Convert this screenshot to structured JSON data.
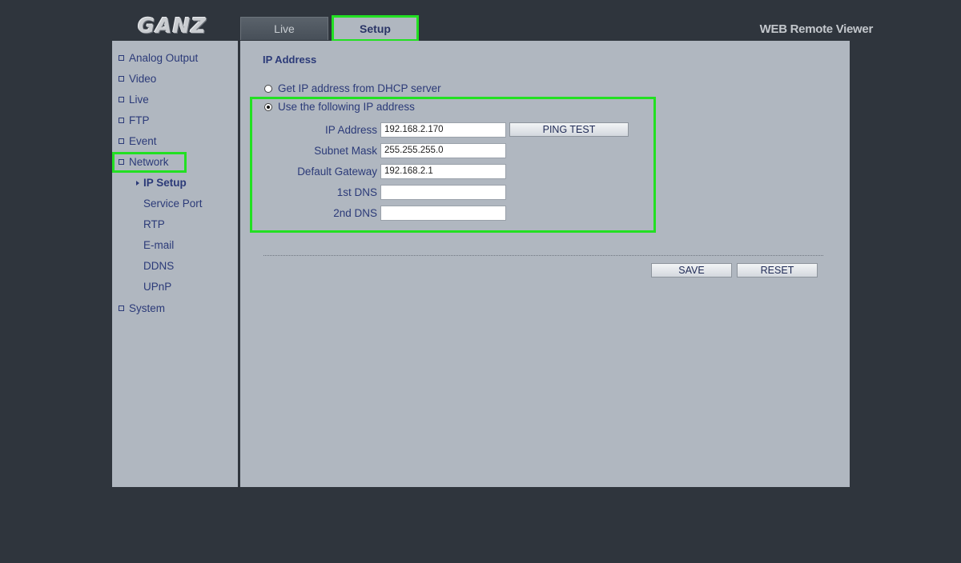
{
  "header": {
    "logo_text": "GANZ",
    "app_title": "WEB Remote Viewer"
  },
  "tabs": [
    {
      "label": "Live",
      "active": false
    },
    {
      "label": "Setup",
      "active": true
    }
  ],
  "sidebar": {
    "items": [
      {
        "label": "Analog Output"
      },
      {
        "label": "Video"
      },
      {
        "label": "Live"
      },
      {
        "label": "FTP"
      },
      {
        "label": "Event"
      },
      {
        "label": "Network"
      },
      {
        "label": "System"
      }
    ],
    "network_sub": [
      {
        "label": "IP Setup",
        "active": true
      },
      {
        "label": "Service Port"
      },
      {
        "label": "RTP"
      },
      {
        "label": "E-mail"
      },
      {
        "label": "DDNS"
      },
      {
        "label": "UPnP"
      }
    ]
  },
  "main": {
    "section_title": "IP Address",
    "radio_dhcp": "Get IP address from DHCP server",
    "radio_static": "Use the following IP address",
    "selected_mode": "static",
    "fields": {
      "ip_address": {
        "label": "IP Address",
        "value": "192.168.2.170"
      },
      "subnet_mask": {
        "label": "Subnet Mask",
        "value": "255.255.255.0"
      },
      "default_gateway": {
        "label": "Default Gateway",
        "value": "192.168.2.1"
      },
      "dns1": {
        "label": "1st DNS",
        "value": ""
      },
      "dns2": {
        "label": "2nd DNS",
        "value": ""
      }
    },
    "ping_button": "PING TEST",
    "save_button": "SAVE",
    "reset_button": "RESET"
  },
  "colors": {
    "background": "#2f353d",
    "panel": "#b0b7c0",
    "text_link": "#2b3a78",
    "highlight": "#22e022"
  }
}
